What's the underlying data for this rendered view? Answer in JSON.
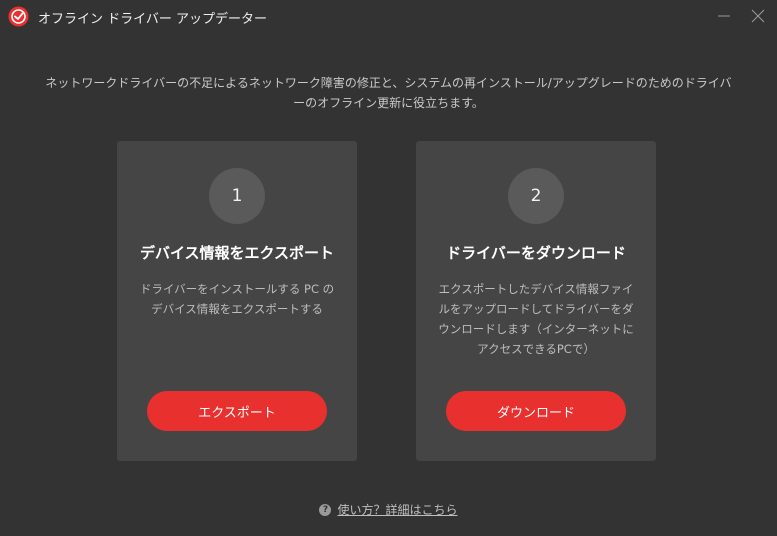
{
  "window": {
    "title": "オフライン ドライバー アップデーター",
    "brand_color": "#e8312f",
    "minimize_icon": "minimize-icon",
    "close_icon": "close-icon"
  },
  "description": {
    "line1": "ネットワークドライバーの不足によるネットワーク障害の修正と、システムの再インストール/アップグレードのためのドライバ",
    "line2": "ーのオフライン更新に役立ちます。"
  },
  "cards": [
    {
      "step": "1",
      "title": "デバイス情報をエクスポート",
      "text": "ドライバーをインストールする PC のデバイス情報をエクスポートする",
      "button": "エクスポート"
    },
    {
      "step": "2",
      "title": "ドライバーをダウンロード",
      "text": "エクスポートしたデバイス情報ファイルをアップロードしてドライバーをダウンロードします（インターネットにアクセスできるPCで）",
      "button": "ダウンロード"
    }
  ],
  "help": {
    "icon_text": "?",
    "link": "使い方？詳細はこちら"
  }
}
